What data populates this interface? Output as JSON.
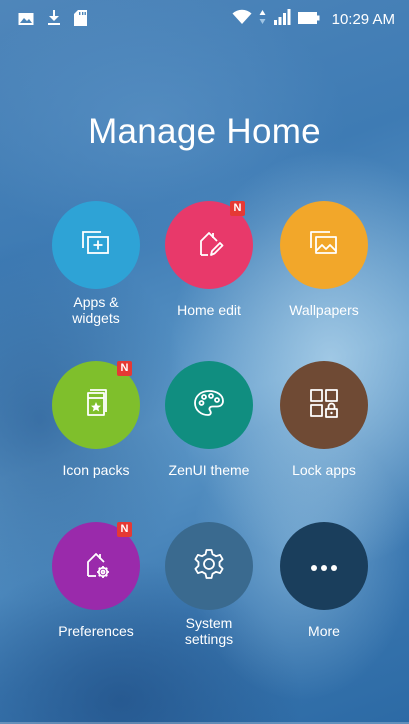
{
  "status_bar": {
    "time": "10:29 AM",
    "left_icons": [
      "image-icon",
      "download-icon",
      "sd-card-icon"
    ],
    "right_icons": [
      "wifi-icon",
      "data-arrows-icon",
      "signal-icon",
      "battery-icon"
    ]
  },
  "title": "Manage Home",
  "items": [
    {
      "name": "apps-widgets",
      "label": "Apps &\nwidgets",
      "icon": "widgets-icon",
      "color": "#2ea3d6",
      "badge": ""
    },
    {
      "name": "home-edit",
      "label": "Home edit",
      "icon": "home-edit-icon",
      "color": "#e8396a",
      "badge": "N"
    },
    {
      "name": "wallpapers",
      "label": "Wallpapers",
      "icon": "wallpaper-icon",
      "color": "#f2a72a",
      "badge": ""
    },
    {
      "name": "icon-packs",
      "label": "Icon packs",
      "icon": "icon-pack-icon",
      "color": "#7fbf2c",
      "badge": "N"
    },
    {
      "name": "zenui-theme",
      "label": "ZenUI theme",
      "icon": "palette-icon",
      "color": "#108e80",
      "badge": ""
    },
    {
      "name": "lock-apps",
      "label": "Lock apps",
      "icon": "lock-apps-icon",
      "color": "#6f4a34",
      "badge": ""
    },
    {
      "name": "preferences",
      "label": "Preferences",
      "icon": "home-settings-icon",
      "color": "#9a2aab",
      "badge": "N"
    },
    {
      "name": "system-settings",
      "label": "System\nsettings",
      "icon": "gear-icon",
      "color": "#3a6a8f",
      "badge": ""
    },
    {
      "name": "more",
      "label": "More",
      "icon": "more-dots-icon",
      "color": "#1a3e5c",
      "badge": ""
    }
  ]
}
